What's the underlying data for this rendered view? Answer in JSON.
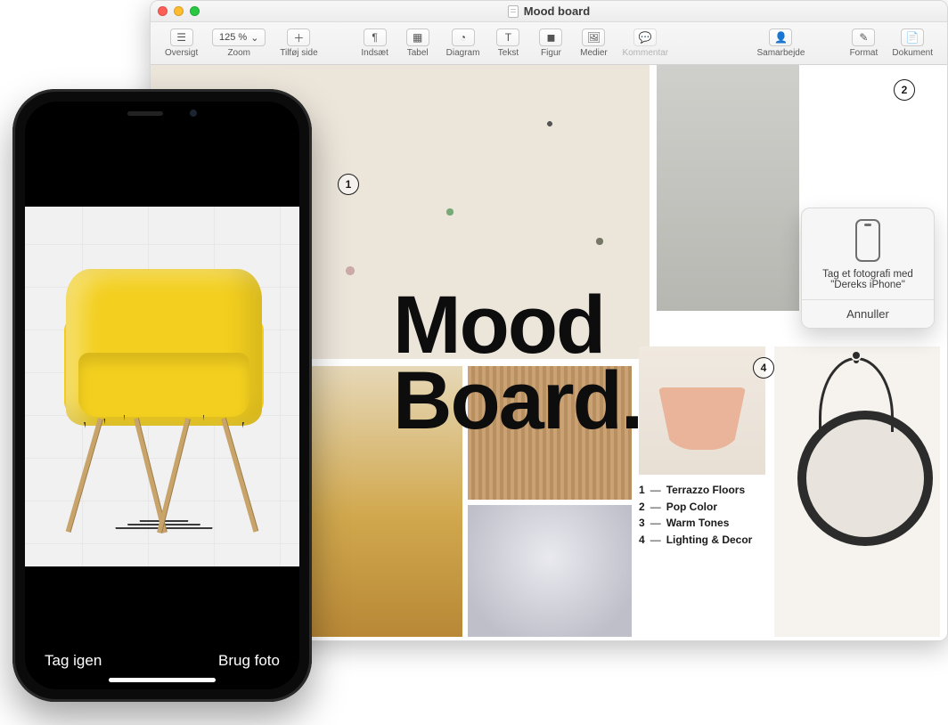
{
  "window": {
    "title": "Mood board",
    "traffic": {
      "close": "close",
      "minimize": "minimize",
      "zoom": "zoom"
    }
  },
  "toolbar": {
    "oversigt": "Oversigt",
    "zoom_value": "125 %",
    "zoom_label": "Zoom",
    "tilfoj_side": "Tilføj side",
    "indsaet": "Indsæt",
    "tabel": "Tabel",
    "diagram": "Diagram",
    "tekst": "Tekst",
    "figur": "Figur",
    "medier": "Medier",
    "kommentar": "Kommentar",
    "samarbejde": "Samarbejde",
    "format": "Format",
    "dokument": "Dokument"
  },
  "document": {
    "big_title": "Mood\nBoard.",
    "legend": [
      {
        "n": "1",
        "label": "Terrazzo Floors"
      },
      {
        "n": "2",
        "label": "Pop Color"
      },
      {
        "n": "3",
        "label": "Warm Tones"
      },
      {
        "n": "4",
        "label": "Lighting & Decor"
      }
    ],
    "callouts": {
      "c1": "1",
      "c2": "2",
      "c4": "4"
    }
  },
  "popover": {
    "line": "Tag et fotografi med \"Dereks iPhone\"",
    "cancel": "Annuller"
  },
  "iphone": {
    "retake": "Tag igen",
    "use_photo": "Brug foto"
  }
}
